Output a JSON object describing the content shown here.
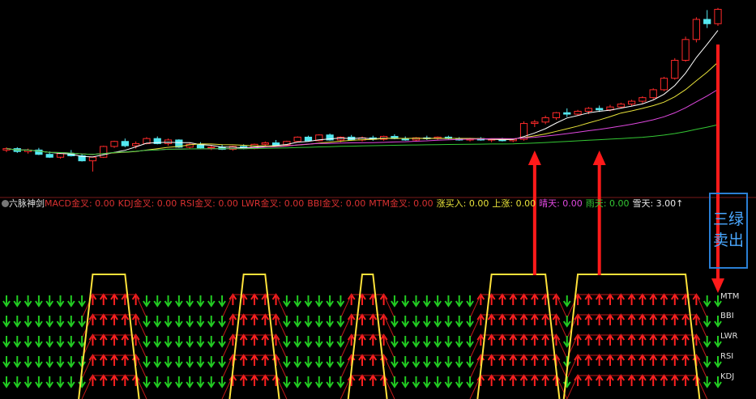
{
  "indicator": {
    "name": "六脉神剑",
    "items": [
      {
        "label": "MACD金叉",
        "value": "0.00",
        "color": "#d83030"
      },
      {
        "label": "KDJ金叉",
        "value": "0.00",
        "color": "#d83030"
      },
      {
        "label": "RSI金叉",
        "value": "0.00",
        "color": "#d83030"
      },
      {
        "label": "LWR金叉",
        "value": "0.00",
        "color": "#d83030"
      },
      {
        "label": "BBI金叉",
        "value": "0.00",
        "color": "#d83030"
      },
      {
        "label": "MTM金叉",
        "value": "0.00",
        "color": "#d83030"
      },
      {
        "label": "涨买入",
        "value": "0.00",
        "color": "#e8e23a"
      },
      {
        "label": "上涨",
        "value": "0.00",
        "color": "#e8e23a"
      },
      {
        "label": "晴天",
        "value": "0.00",
        "color": "#e048e0"
      },
      {
        "label": "雨天",
        "value": "0.00",
        "color": "#34c834"
      },
      {
        "label": "雪天",
        "value": "3.00",
        "color": "#e8e8e8",
        "suffix": "↑"
      }
    ]
  },
  "annotation": {
    "line1": "三绿",
    "line2": "卖出"
  },
  "row_labels": [
    "MTM",
    "BBI",
    "LWR",
    "RSI",
    "KDJ"
  ],
  "colors": {
    "up": "#ff2a2a",
    "down": "#54e8f0",
    "ma5": "#ffffff",
    "ma10": "#e8e23a",
    "ma20": "#e048e0",
    "ma60": "#34c834",
    "arrow_up": "#ff2020",
    "arrow_down": "#22cc22",
    "pulse": "#ffe23a",
    "sell_box": "#2a7fd4"
  },
  "chart_data": {
    "type": "candlestick",
    "note_series": [
      "K-line with moving averages",
      "six-row signal arrows",
      "yellow pulse"
    ],
    "candles": [
      {
        "o": 5.0,
        "h": 5.4,
        "l": 4.7,
        "c": 5.2
      },
      {
        "o": 5.2,
        "h": 5.4,
        "l": 4.6,
        "c": 4.8
      },
      {
        "o": 4.8,
        "h": 5.2,
        "l": 4.5,
        "c": 5.0
      },
      {
        "o": 5.0,
        "h": 5.3,
        "l": 4.3,
        "c": 4.4
      },
      {
        "o": 4.4,
        "h": 4.8,
        "l": 3.9,
        "c": 4.0
      },
      {
        "o": 4.0,
        "h": 4.6,
        "l": 3.8,
        "c": 4.5
      },
      {
        "o": 4.5,
        "h": 5.0,
        "l": 4.1,
        "c": 4.2
      },
      {
        "o": 4.2,
        "h": 4.4,
        "l": 3.4,
        "c": 3.5
      },
      {
        "o": 3.5,
        "h": 4.1,
        "l": 2.0,
        "c": 4.0
      },
      {
        "o": 4.0,
        "h": 5.6,
        "l": 3.9,
        "c": 5.5
      },
      {
        "o": 5.5,
        "h": 6.3,
        "l": 5.3,
        "c": 6.2
      },
      {
        "o": 6.2,
        "h": 6.6,
        "l": 5.4,
        "c": 5.6
      },
      {
        "o": 5.6,
        "h": 6.2,
        "l": 5.2,
        "c": 5.9
      },
      {
        "o": 5.9,
        "h": 6.8,
        "l": 5.8,
        "c": 6.6
      },
      {
        "o": 6.6,
        "h": 6.9,
        "l": 5.8,
        "c": 5.9
      },
      {
        "o": 5.9,
        "h": 6.6,
        "l": 5.6,
        "c": 6.4
      },
      {
        "o": 6.4,
        "h": 6.5,
        "l": 5.3,
        "c": 5.4
      },
      {
        "o": 5.4,
        "h": 6.0,
        "l": 5.2,
        "c": 5.8
      },
      {
        "o": 5.8,
        "h": 6.1,
        "l": 5.2,
        "c": 5.3
      },
      {
        "o": 5.3,
        "h": 5.7,
        "l": 5.0,
        "c": 5.4
      },
      {
        "o": 5.4,
        "h": 5.8,
        "l": 5.0,
        "c": 5.1
      },
      {
        "o": 5.1,
        "h": 5.6,
        "l": 4.9,
        "c": 5.5
      },
      {
        "o": 5.5,
        "h": 5.8,
        "l": 5.1,
        "c": 5.2
      },
      {
        "o": 5.2,
        "h": 5.9,
        "l": 5.1,
        "c": 5.8
      },
      {
        "o": 5.8,
        "h": 6.2,
        "l": 5.6,
        "c": 6.0
      },
      {
        "o": 6.0,
        "h": 6.4,
        "l": 5.6,
        "c": 5.7
      },
      {
        "o": 5.7,
        "h": 6.3,
        "l": 5.6,
        "c": 6.2
      },
      {
        "o": 6.2,
        "h": 6.9,
        "l": 6.1,
        "c": 6.8
      },
      {
        "o": 6.8,
        "h": 7.0,
        "l": 6.2,
        "c": 6.3
      },
      {
        "o": 6.3,
        "h": 7.2,
        "l": 6.2,
        "c": 7.1
      },
      {
        "o": 7.1,
        "h": 7.3,
        "l": 6.3,
        "c": 6.4
      },
      {
        "o": 6.4,
        "h": 6.9,
        "l": 6.1,
        "c": 6.8
      },
      {
        "o": 6.8,
        "h": 7.1,
        "l": 6.3,
        "c": 6.4
      },
      {
        "o": 6.4,
        "h": 6.9,
        "l": 6.2,
        "c": 6.7
      },
      {
        "o": 6.7,
        "h": 7.0,
        "l": 6.3,
        "c": 6.5
      },
      {
        "o": 6.5,
        "h": 7.0,
        "l": 6.3,
        "c": 6.9
      },
      {
        "o": 6.9,
        "h": 7.2,
        "l": 6.5,
        "c": 6.6
      },
      {
        "o": 6.6,
        "h": 6.9,
        "l": 6.3,
        "c": 6.4
      },
      {
        "o": 6.4,
        "h": 6.8,
        "l": 6.2,
        "c": 6.7
      },
      {
        "o": 6.7,
        "h": 7.0,
        "l": 6.4,
        "c": 6.6
      },
      {
        "o": 6.6,
        "h": 6.9,
        "l": 6.4,
        "c": 6.8
      },
      {
        "o": 6.8,
        "h": 7.0,
        "l": 6.5,
        "c": 6.6
      },
      {
        "o": 6.6,
        "h": 6.8,
        "l": 6.3,
        "c": 6.4
      },
      {
        "o": 6.4,
        "h": 6.7,
        "l": 6.2,
        "c": 6.6
      },
      {
        "o": 6.6,
        "h": 6.8,
        "l": 6.3,
        "c": 6.4
      },
      {
        "o": 6.4,
        "h": 6.6,
        "l": 6.1,
        "c": 6.5
      },
      {
        "o": 6.5,
        "h": 6.7,
        "l": 6.2,
        "c": 6.3
      },
      {
        "o": 6.3,
        "h": 6.6,
        "l": 6.1,
        "c": 6.5
      },
      {
        "o": 6.5,
        "h": 9.0,
        "l": 6.3,
        "c": 8.7
      },
      {
        "o": 8.7,
        "h": 9.2,
        "l": 8.2,
        "c": 8.9
      },
      {
        "o": 8.9,
        "h": 9.8,
        "l": 8.6,
        "c": 9.5
      },
      {
        "o": 9.5,
        "h": 10.3,
        "l": 9.2,
        "c": 10.2
      },
      {
        "o": 10.2,
        "h": 10.8,
        "l": 9.6,
        "c": 10.0
      },
      {
        "o": 10.0,
        "h": 10.6,
        "l": 9.8,
        "c": 10.4
      },
      {
        "o": 10.4,
        "h": 11.0,
        "l": 10.0,
        "c": 10.8
      },
      {
        "o": 10.8,
        "h": 11.2,
        "l": 10.3,
        "c": 10.6
      },
      {
        "o": 10.6,
        "h": 11.3,
        "l": 10.4,
        "c": 11.0
      },
      {
        "o": 11.0,
        "h": 11.6,
        "l": 10.8,
        "c": 11.4
      },
      {
        "o": 11.4,
        "h": 12.0,
        "l": 11.1,
        "c": 11.8
      },
      {
        "o": 11.8,
        "h": 12.5,
        "l": 11.5,
        "c": 12.3
      },
      {
        "o": 12.3,
        "h": 13.6,
        "l": 12.1,
        "c": 13.4
      },
      {
        "o": 13.4,
        "h": 15.2,
        "l": 13.2,
        "c": 15.0
      },
      {
        "o": 15.0,
        "h": 17.8,
        "l": 14.8,
        "c": 17.5
      },
      {
        "o": 17.5,
        "h": 20.8,
        "l": 17.3,
        "c": 20.4
      },
      {
        "o": 20.4,
        "h": 23.5,
        "l": 20.0,
        "c": 23.2
      },
      {
        "o": 23.2,
        "h": 24.5,
        "l": 22.0,
        "c": 22.6
      },
      {
        "o": 22.6,
        "h": 24.8,
        "l": 22.3,
        "c": 24.6
      }
    ],
    "pulse_segments": [
      [
        8,
        11
      ],
      [
        22,
        24
      ],
      [
        33,
        34
      ],
      [
        45,
        50
      ],
      [
        53,
        63
      ]
    ],
    "up_arrow_ranges": [
      [
        8,
        12
      ],
      [
        21,
        25
      ],
      [
        32,
        35
      ],
      [
        44,
        51
      ],
      [
        53,
        64
      ]
    ],
    "red_arrow_markers": [
      49,
      55,
      66
    ]
  }
}
